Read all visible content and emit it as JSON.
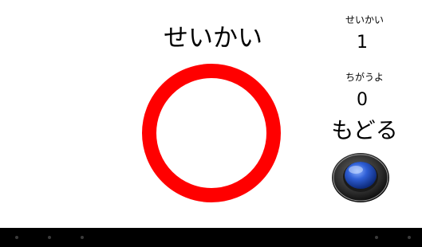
{
  "result": {
    "title": "せいかい",
    "mark": "circle-mark-icon",
    "mark_color": "#ff0000"
  },
  "score": {
    "correct_label": "せいかい",
    "correct_count": "1",
    "wrong_label": "ちがうよ",
    "wrong_count": "0"
  },
  "back": {
    "label": "もどる",
    "button_icon": "blue-round-button-icon",
    "button_color": "#1f4fc4"
  },
  "nav_bar": {
    "items": [
      "nav-dot",
      "nav-dot",
      "nav-dot",
      "nav-dot",
      "nav-dot"
    ]
  }
}
